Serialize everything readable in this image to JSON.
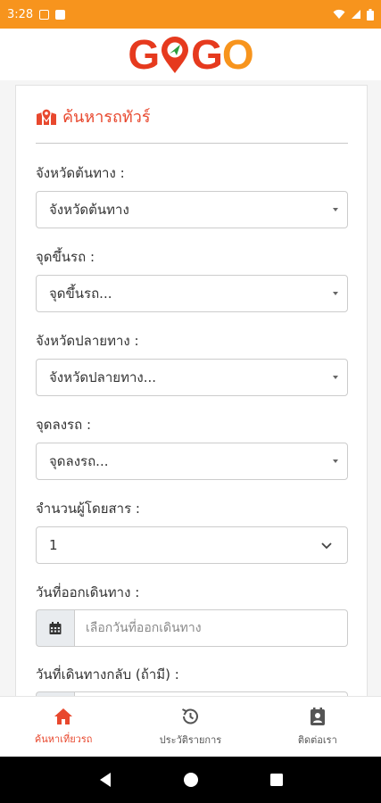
{
  "status_bar": {
    "time": "3:28"
  },
  "header": {
    "logo_text": [
      "G",
      "G",
      "O"
    ]
  },
  "search": {
    "title": "ค้นหารถทัวร์",
    "origin_province": {
      "label": "จังหวัดต้นทาง :",
      "value": "จังหวัดต้นทาง"
    },
    "pickup_point": {
      "label": "จุดขึ้นรถ :",
      "value": "จุดขึ้นรถ..."
    },
    "destination_province": {
      "label": "จังหวัดปลายทาง :",
      "value": "จังหวัดปลายทาง..."
    },
    "dropoff_point": {
      "label": "จุดลงรถ :",
      "value": "จุดลงรถ..."
    },
    "passengers": {
      "label": "จำนวนผู้โดยสาร :",
      "value": "1"
    },
    "departure_date": {
      "label": "วันที่ออกเดินทาง :",
      "placeholder": "เลือกวันที่ออกเดินทาง"
    },
    "return_date": {
      "label": "วันที่เดินทางกลับ (ถ้ามี) :",
      "placeholder": ""
    }
  },
  "bottom_nav": [
    {
      "label": "ค้นหาเที่ยวรถ",
      "icon": "home-icon",
      "active": true
    },
    {
      "label": "ประวัติรายการ",
      "icon": "history-icon",
      "active": false
    },
    {
      "label": "ติดต่อเรา",
      "icon": "contact-icon",
      "active": false
    }
  ],
  "colors": {
    "accent": "#f7941d",
    "brand_red": "#e8482e"
  }
}
